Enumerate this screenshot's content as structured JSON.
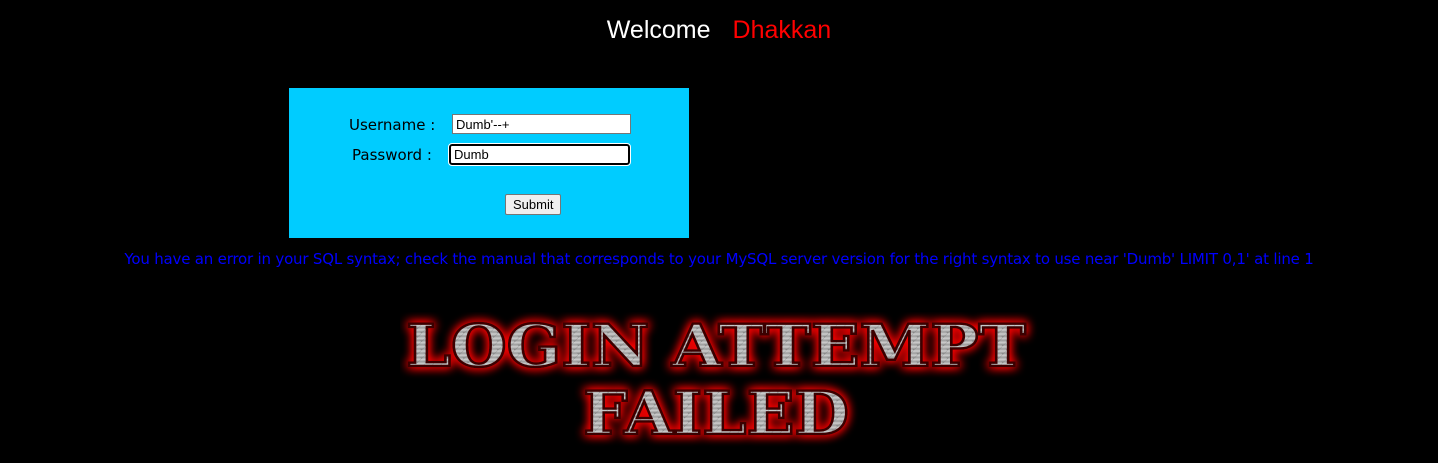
{
  "header": {
    "welcome": "Welcome",
    "name": "Dhakkan"
  },
  "login_form": {
    "username_label": "Username :",
    "username_value": "Dumb'--+",
    "password_label": "Password :",
    "password_value": "Dumb",
    "submit_label": "Submit"
  },
  "error_message": "You have an error in your SQL syntax; check the manual that corresponds to your MySQL server version for the right syntax to use near 'Dumb' LIMIT 0,1' at line 1",
  "banner": {
    "line1": "LOGIN ATTEMPT",
    "line2": "FAILED"
  },
  "colors": {
    "background": "#000000",
    "form_background": "#00ccff",
    "welcome": "#ffffff",
    "name": "#ff0000",
    "error": "#0000ff",
    "banner_glow": "#ff0000"
  }
}
